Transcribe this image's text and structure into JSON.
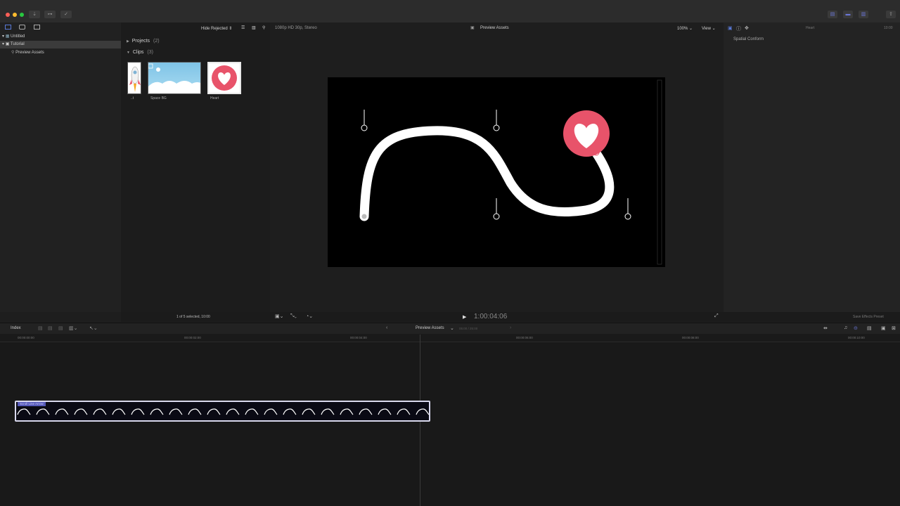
{
  "toolbar": {
    "hide_rejected": "Hide Rejected",
    "format": "1080p HD 30p, Stereo",
    "viewer_title": "Preview Assets",
    "zoom": "100%",
    "view": "View",
    "inspector_clip": "Heart",
    "inspector_time": "10:00"
  },
  "libraries": {
    "items": [
      {
        "label": "Untitled"
      },
      {
        "label": "Tutorial"
      },
      {
        "label": "Preview Assets"
      }
    ]
  },
  "browser": {
    "projects_label": "Projects",
    "projects_count": "(2)",
    "clips_label": "Clips",
    "clips_count": "(3)",
    "clips": [
      {
        "name": "..t"
      },
      {
        "name": "Space BG"
      },
      {
        "name": "Heart"
      }
    ],
    "selection_status": "1 of 5 selected, 10:00"
  },
  "inspector": {
    "spatial_conform": "Spatial Conform",
    "save_preset": "Save Effects Preset"
  },
  "transport": {
    "timecode": "1:00:04:06"
  },
  "timeline": {
    "index_label": "Index",
    "project_name": "Preview Assets",
    "duration": "05:00 / 25:00",
    "ruler_labels": [
      "00:00:00:00",
      "00:00:02:00",
      "00:00:04:00",
      "00:00:06:00",
      "00:00:08:00",
      "00:00:10:00"
    ],
    "clip_title": "Scroll Line Arrow"
  },
  "colors": {
    "accent_blue": "#5559b8",
    "heart_red": "#e8536a"
  }
}
